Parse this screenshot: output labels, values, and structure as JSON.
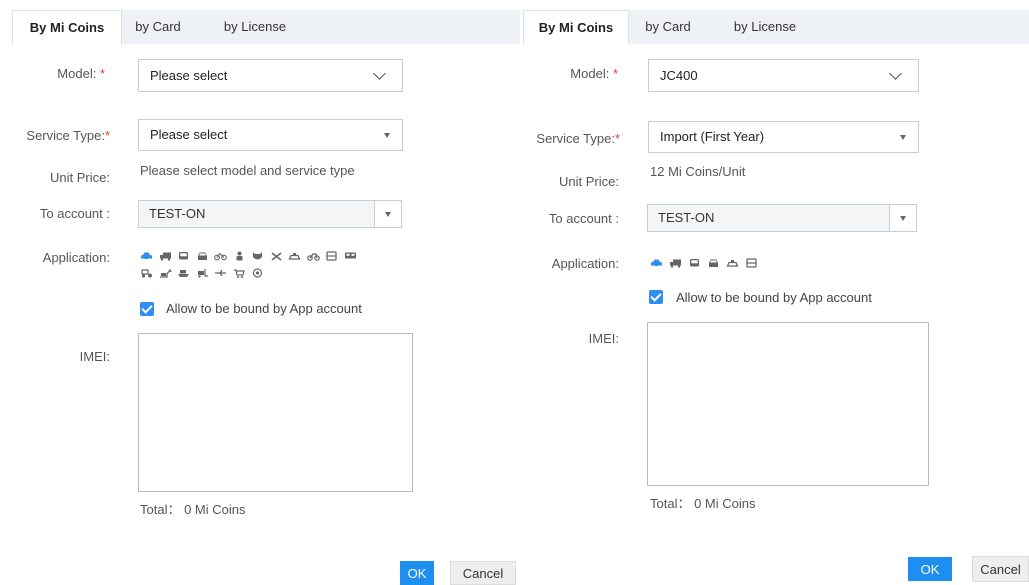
{
  "left": {
    "tabs": [
      "By Mi Coins",
      "by Card",
      "by License"
    ],
    "model_label": "Model: ",
    "model_value": "Please select",
    "service_label": "Service Type:",
    "service_value": "Please select",
    "unit_price_label": "Unit Price:",
    "unit_price_value": "Please select model and service type",
    "account_label": "To account :",
    "account_value": "TEST-ON",
    "application_label": "Application:",
    "icons_row1": [
      "car-icon",
      "truck-icon",
      "bus-icon",
      "car-front-icon",
      "bicycle-icon",
      "person-icon",
      "animal-icon",
      "tools-icon",
      "taxi-icon",
      "motorcycle-icon",
      "coach-icon",
      "train-icon"
    ],
    "icons_row2": [
      "tractor-icon",
      "excavator-icon",
      "ship-icon",
      "forklift-icon",
      "plane-icon",
      "cart-icon",
      "target-icon"
    ],
    "allow_label": "Allow to be bound by App account",
    "imei_label": "IMEI:",
    "total": "Total： 0 Mi Coins",
    "ok": "OK",
    "cancel": "Cancel"
  },
  "right": {
    "tabs": [
      "By Mi Coins",
      "by Card",
      "by License"
    ],
    "model_label": "Model: ",
    "model_value": "JC400",
    "service_label": "Service Type:",
    "service_value": "Import (First Year)",
    "unit_price_label": "Unit Price:",
    "unit_price_value": "12 Mi Coins/Unit",
    "account_label": "To account :",
    "account_value": "TEST-ON",
    "application_label": "Application:",
    "icons_row1": [
      "car-icon",
      "truck-icon",
      "bus-icon",
      "car-front-icon",
      "taxi-icon",
      "coach-icon"
    ],
    "allow_label": "Allow to be bound by App account",
    "imei_label": "IMEI:",
    "total": "Total： 0 Mi Coins",
    "ok": "OK",
    "cancel": "Cancel"
  },
  "required_mark": "*",
  "colors": {
    "accent": "#1e8ef1",
    "icon_active": "#2f8ff0",
    "icon": "#666666",
    "required": "#e0412f"
  }
}
